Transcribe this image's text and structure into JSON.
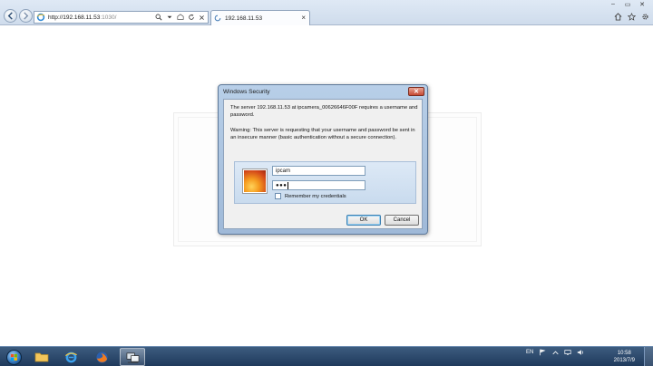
{
  "browser": {
    "url_host": "http://192.168.11.53",
    "url_port": ":1030/",
    "tab_title": "192.168.11.53"
  },
  "dialog": {
    "title": "Windows Security",
    "message": "The server 192.168.11.53 at ipcamera_00626646F00F requires a username and password.",
    "warning": "Warning: This server is requesting that your username and password be sent in an insecure manner (basic authentication without a secure connection).",
    "username_value": "ipcam",
    "password_value": "●●●",
    "remember_label": "Remember my credentials",
    "remember_checked": false,
    "ok_label": "OK",
    "cancel_label": "Cancel"
  },
  "taskbar": {
    "language": "EN",
    "time": "10:58",
    "date": "2013/7/9",
    "pinned_icons": [
      "folder-icon",
      "ie-icon",
      "firefox-icon",
      "network-app-icon"
    ]
  },
  "colors": {
    "dialog_frame": "#b8cfe8",
    "taskbar": "#2a4a70",
    "close_red": "#c74a33"
  }
}
